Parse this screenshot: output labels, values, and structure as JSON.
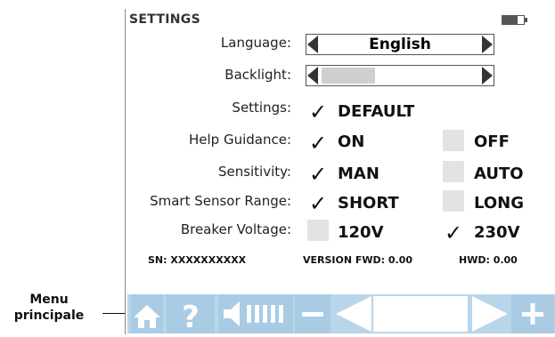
{
  "header": {
    "title": "SETTINGS"
  },
  "rows": {
    "language": {
      "label": "Language:",
      "value": "English"
    },
    "backlight": {
      "label": "Backlight:",
      "level": 0.3
    },
    "settings": {
      "label": "Settings:",
      "option": "DEFAULT",
      "checked": true
    },
    "help": {
      "label": "Help Guidance:",
      "on": "ON",
      "off": "OFF",
      "selected": "ON"
    },
    "sensitivity": {
      "label": "Sensitivity:",
      "man": "MAN",
      "auto": "AUTO",
      "selected": "MAN"
    },
    "range": {
      "label": "Smart Sensor Range:",
      "short": "SHORT",
      "long": "LONG",
      "selected": "SHORT"
    },
    "breaker": {
      "label": "Breaker Voltage:",
      "v120": "120V",
      "v230": "230V",
      "selected": "230V"
    }
  },
  "info": {
    "sn": "SN: XXXXXXXXXX",
    "version": "VERSION FWD: 0.00",
    "hwd": "HWD: 0.00"
  },
  "callout": {
    "line1": "Menu",
    "line2": "principale"
  },
  "icons": [
    "battery-icon",
    "home-icon",
    "help-icon",
    "volume-icon",
    "minus-icon",
    "left-arrow-icon",
    "right-arrow-icon",
    "plus-icon"
  ],
  "colors": {
    "menu_bg": "#b8d5ea",
    "menu_btn": "#a9cbe4",
    "box": "#e3e3e3"
  }
}
